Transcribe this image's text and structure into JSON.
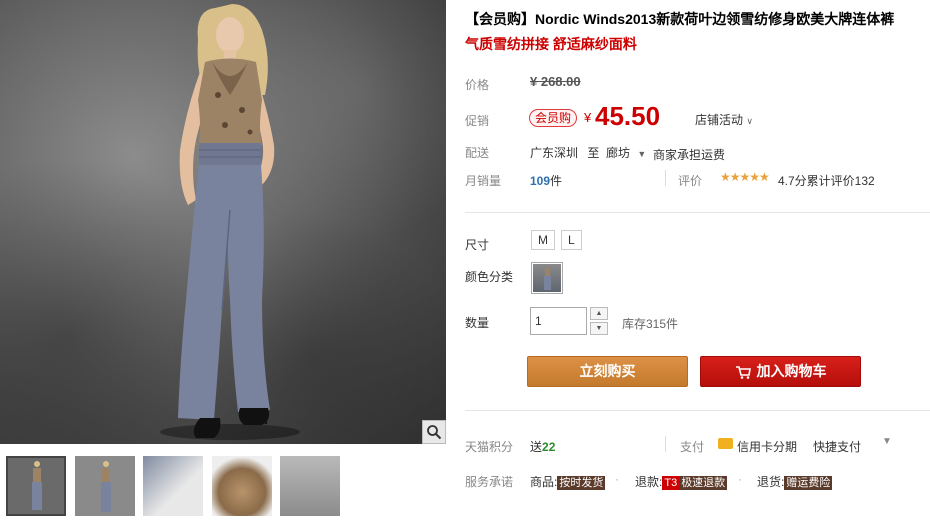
{
  "product": {
    "title": "【会员购】Nordic Winds2013新款荷叶边领雪纺修身欧美大牌连体裤",
    "subtitle": "气质雪纺拼接 舒适麻纱面料"
  },
  "price": {
    "label": "价格",
    "original": "¥ 268.00",
    "promo_label": "促销",
    "promo_tag": "会员购",
    "yen": "¥",
    "value": "45.50",
    "shop_activity": "店铺活动"
  },
  "shipping": {
    "label": "配送",
    "from": "广东深圳",
    "to_word": "至",
    "to": "廊坊",
    "fee": "商家承担运费"
  },
  "sales": {
    "label": "月销量",
    "count": "109",
    "unit": "件",
    "rating_label": "评价",
    "stars": "★★★★★",
    "rating_text": "4.7分累计评价132"
  },
  "options": {
    "size_label": "尺寸",
    "sizes": [
      "M",
      "L"
    ],
    "color_label": "颜色分类",
    "qty_label": "数量",
    "qty_value": "1",
    "stock": "库存315件"
  },
  "actions": {
    "buy": "立刻购买",
    "cart": "加入购物车"
  },
  "extras": {
    "points_label": "天猫积分",
    "points_prefix": "送",
    "points_value": "22",
    "pay_label": "支付",
    "card_pay": "信用卡分期",
    "quick_pay": "快捷支付",
    "service_label": "服务承诺",
    "svc_goods_prefix": "商品:",
    "svc_goods_tag": "按时发货",
    "svc_refund_prefix": "退款:",
    "svc_refund_t3": "T3",
    "svc_refund_tag": "极速退款",
    "svc_return_prefix": "退货:",
    "svc_return_tag": "赠运费险"
  },
  "colors": {
    "price_red": "#cc0000",
    "buy_orange": "#d0873a",
    "cart_red": "#c8140f"
  }
}
